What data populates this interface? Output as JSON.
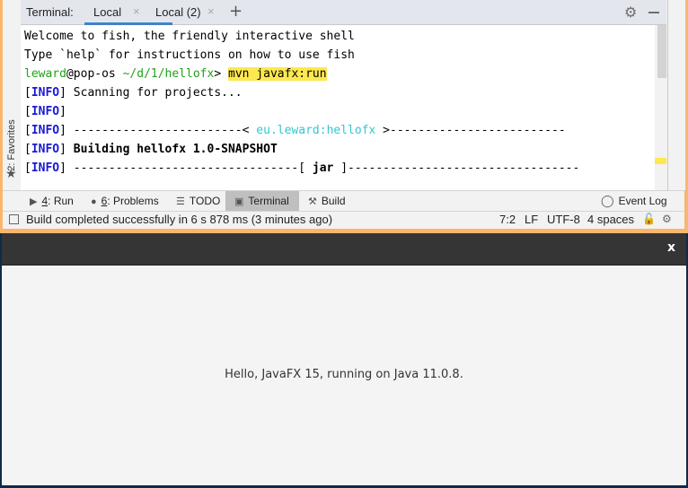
{
  "ide": {
    "tool_window": {
      "title": "Terminal:",
      "tabs": [
        {
          "label": "Local",
          "active": true
        },
        {
          "label": "Local (2)",
          "active": false
        }
      ],
      "add_tab_icon": "+",
      "close_icon": "×",
      "settings_icon": "gear-icon",
      "hide_icon": "minimize-icon"
    },
    "left_sidebar": {
      "favorites_label": "2: Favorites",
      "favorites_icon": "★"
    },
    "terminal": {
      "lines": {
        "l1": "Welcome to fish, the friendly interactive shell",
        "l2": "Type `help` for instructions on how to use fish",
        "prompt_user": "leward",
        "prompt_host": "@pop-os",
        "prompt_path": " ~/d/1/hellofx",
        "prompt_sym": "> ",
        "command": "mvn javafx:run",
        "info_tag": "INFO",
        "l4": "Scanning for projects...",
        "l6_left": "------------------------< ",
        "l6_mid": "eu.leward:hellofx",
        "l6_right": " >-------------------------",
        "l7": "Building hellofx 1.0-SNAPSHOT",
        "l8_left": "--------------------------------[ ",
        "l8_mid": "jar",
        "l8_right": " ]---------------------------------"
      }
    },
    "bottom_toolbar": {
      "items": [
        {
          "num": "4",
          "label": ": Run",
          "icon": "▶"
        },
        {
          "num": "6",
          "label": ": Problems",
          "icon": "●"
        },
        {
          "label": "TODO",
          "icon": "☰"
        },
        {
          "label": "Terminal",
          "icon": "▣",
          "active": true
        },
        {
          "label": "Build",
          "icon": "🔨"
        }
      ],
      "event_log": "Event Log"
    },
    "status_bar": {
      "message": "Build completed successfully in 6 s 878 ms (3 minutes ago)",
      "position": "7:2",
      "line_sep": "LF",
      "encoding": "UTF-8",
      "indent": "4 spaces"
    }
  },
  "javafx_window": {
    "close_label": "x",
    "message": "Hello, JavaFX 15, running on Java 11.0.8."
  }
}
